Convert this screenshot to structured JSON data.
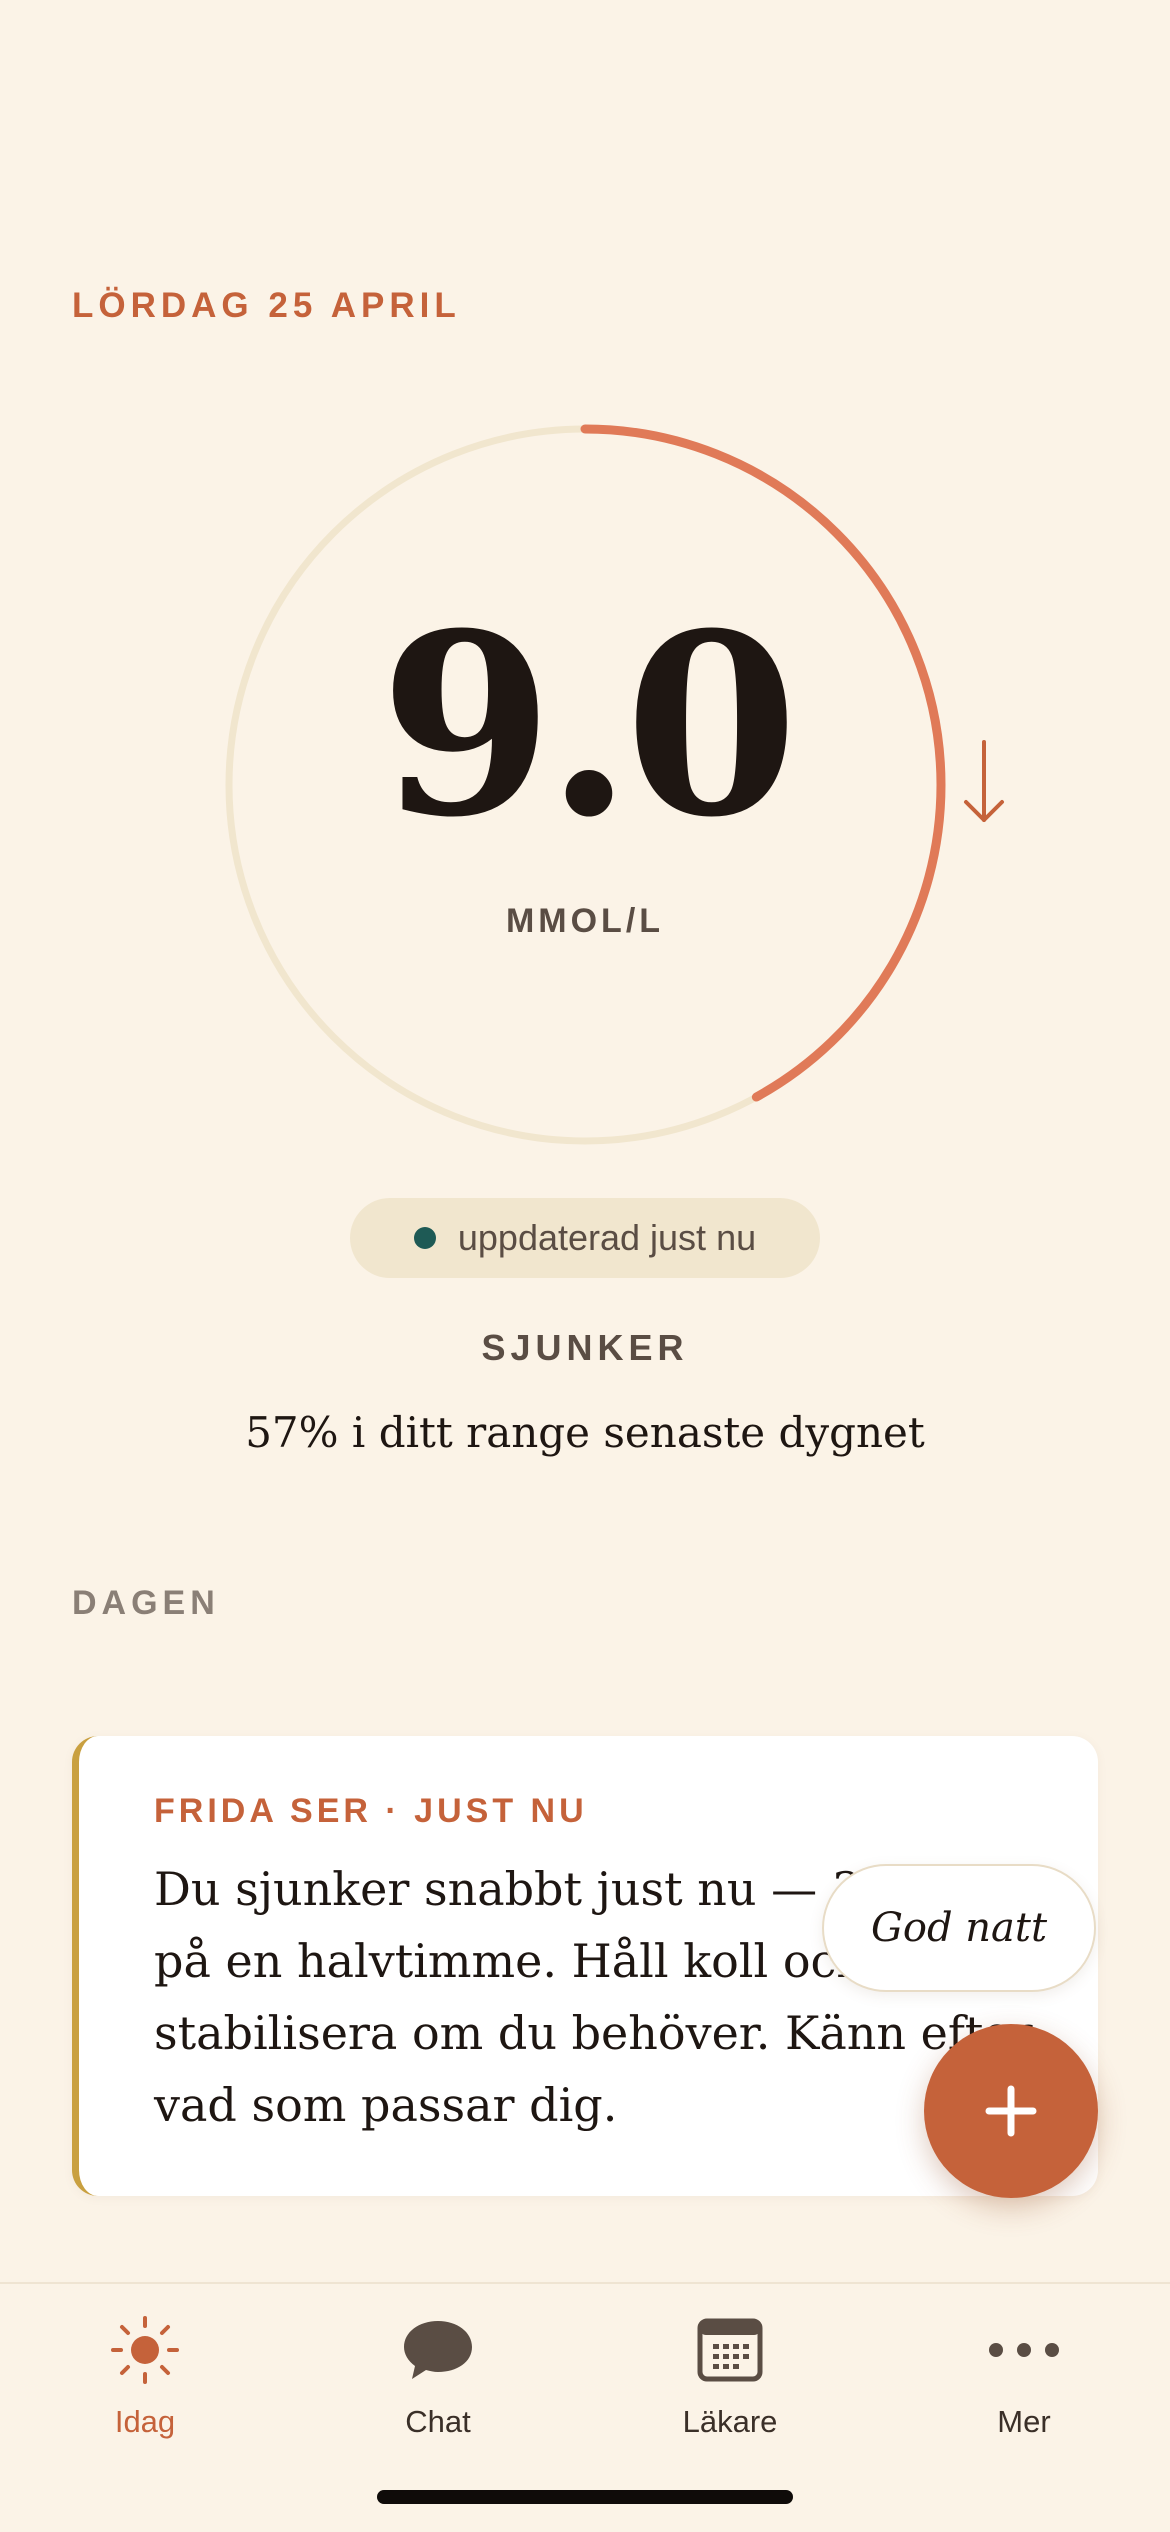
{
  "header": {
    "date": "LÖRDAG 25 APRIL"
  },
  "glucose": {
    "value": "9.0",
    "unit": "MMOL/L",
    "trend_icon": "arrow-down-icon",
    "ring_fill_fraction": 0.42,
    "updated": "uppdaterad just nu",
    "status": "SJUNKER",
    "range_text": "57% i ditt range senaste dygnet"
  },
  "section": {
    "title": "DAGEN"
  },
  "card": {
    "label": "FRIDA SER · JUST NU",
    "text": "Du sjunker snabbt just nu — 3.3 ner på en halvtimme. Håll koll och stabilisera om du behöver. Känn efter vad som passar dig."
  },
  "chip": {
    "label": "God natt"
  },
  "fab": {
    "icon": "plus-icon"
  },
  "tabs": [
    {
      "label": "Idag",
      "icon": "sun-icon",
      "active": true
    },
    {
      "label": "Chat",
      "icon": "chat-bubble-icon",
      "active": false
    },
    {
      "label": "Läkare",
      "icon": "calendar-icon",
      "active": false
    },
    {
      "label": "Mer",
      "icon": "more-dots-icon",
      "active": false
    }
  ],
  "colors": {
    "background": "#FBF3E7",
    "accent": "#C5623A",
    "ring_progress": "#E07A58",
    "ring_track": "#F1E6CE",
    "live_dot": "#1E5A55",
    "card_border": "#C9A040",
    "inactive_tab": "#5A4D44"
  }
}
